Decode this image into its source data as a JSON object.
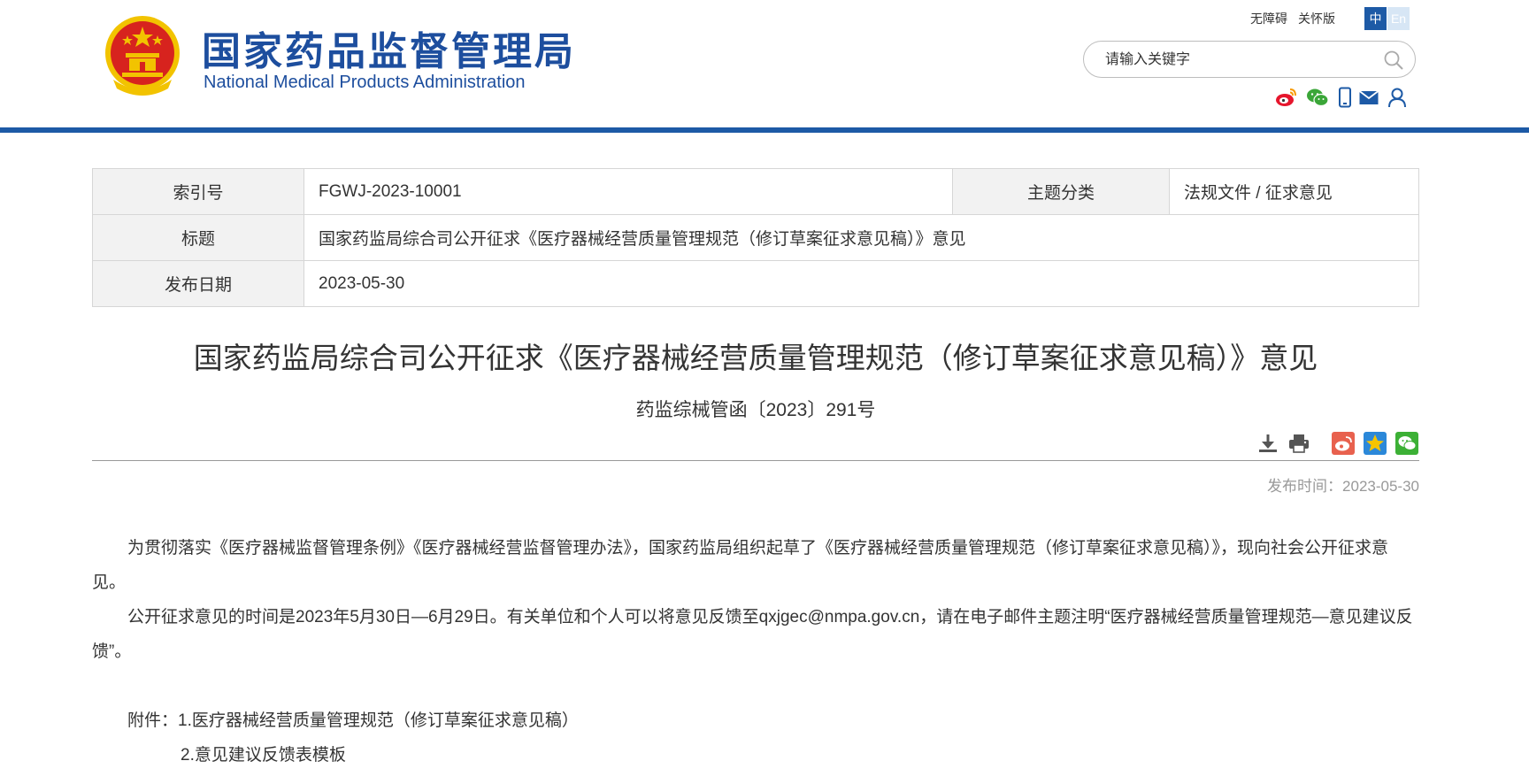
{
  "header": {
    "logo_cn": "国家药品监督管理局",
    "logo_en": "National Medical Products Administration",
    "links": [
      "无障碍",
      "关怀版"
    ],
    "lang_zh": "中",
    "lang_en": "En",
    "search_placeholder": "请输入关键字",
    "social_icons": [
      "weibo-icon",
      "wechat-icon",
      "mobile-icon",
      "mail-icon",
      "user-icon"
    ]
  },
  "colors": {
    "brand_blue": "#1d5aa6",
    "emblem_red": "#d7231e",
    "emblem_gold": "#f2c300"
  },
  "info": {
    "index_label": "索引号",
    "index_value": "FGWJ-2023-10001",
    "category_label": "主题分类",
    "category_value": "法规文件 / 征求意见",
    "title_label": "标题",
    "title_value": "国家药监局综合司公开征求《医疗器械经营质量管理规范（修订草案征求意见稿）》意见",
    "date_label": "发布日期",
    "date_value": "2023-05-30"
  },
  "article": {
    "title": "国家药监局综合司公开征求《医疗器械经营质量管理规范（修订草案征求意见稿）》意见",
    "doc_no": "药监综械管函〔2023〕291号",
    "tools": [
      "download-icon",
      "print-icon",
      "weibo-share-icon",
      "qzone-share-icon",
      "wechat-share-icon"
    ],
    "pub_time": "发布时间：2023-05-30",
    "para1": "为贯彻落实《医疗器械监督管理条例》《医疗器械经营监督管理办法》，国家药监局组织起草了《医疗器械经营质量管理规范（修订草案征求意见稿）》，现向社会公开征求意见。",
    "para2": "公开征求意见的时间是2023年5月30日—6月29日。有关单位和个人可以将意见反馈至qxjgec@nmpa.gov.cn，请在电子邮件主题注明“医疗器械经营质量管理规范—意见建议反馈”。",
    "attachment1": "附件：1.医疗器械经营质量管理规范（修订草案征求意见稿）",
    "attachment2": "2.意见建议反馈表模板"
  }
}
